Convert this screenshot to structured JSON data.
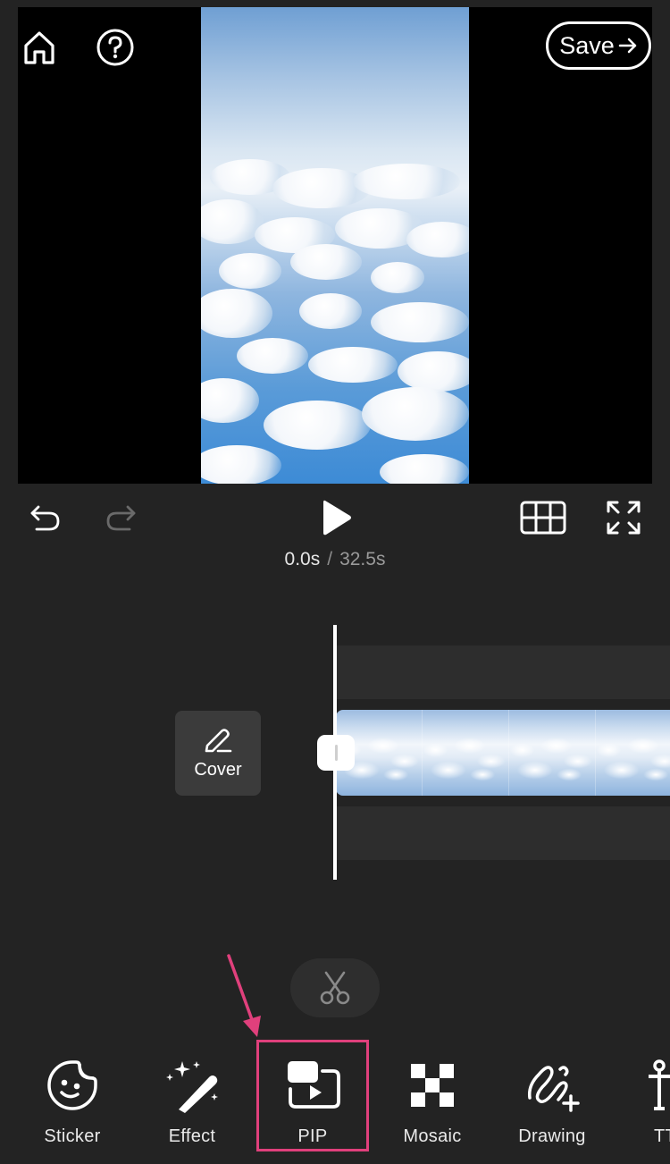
{
  "header": {
    "home_icon": "home-icon",
    "help_icon": "help-icon",
    "save_label": "Save",
    "save_icon": "arrow-right-icon"
  },
  "playback": {
    "undo_icon": "undo-icon",
    "redo_icon": "redo-icon",
    "play_icon": "play-icon",
    "grid_icon": "grid-icon",
    "fullscreen_icon": "fullscreen-icon",
    "current_time": "0.0s",
    "separator": "/",
    "total_time": "32.5s"
  },
  "timeline": {
    "cover_label": "Cover",
    "cover_icon": "pencil-icon",
    "split_icon": "scissors-icon"
  },
  "toolbar": {
    "items": [
      {
        "label": "Sticker",
        "icon": "sticker-icon"
      },
      {
        "label": "Effect",
        "icon": "magic-wand-icon"
      },
      {
        "label": "PIP",
        "icon": "pip-icon",
        "highlighted": true
      },
      {
        "label": "Mosaic",
        "icon": "mosaic-icon"
      },
      {
        "label": "Drawing",
        "icon": "drawing-icon"
      },
      {
        "label": "TT",
        "icon": "text-icon"
      }
    ]
  },
  "colors": {
    "background": "#232323",
    "highlight": "#e0407c",
    "panel": "#2d2d2d"
  }
}
